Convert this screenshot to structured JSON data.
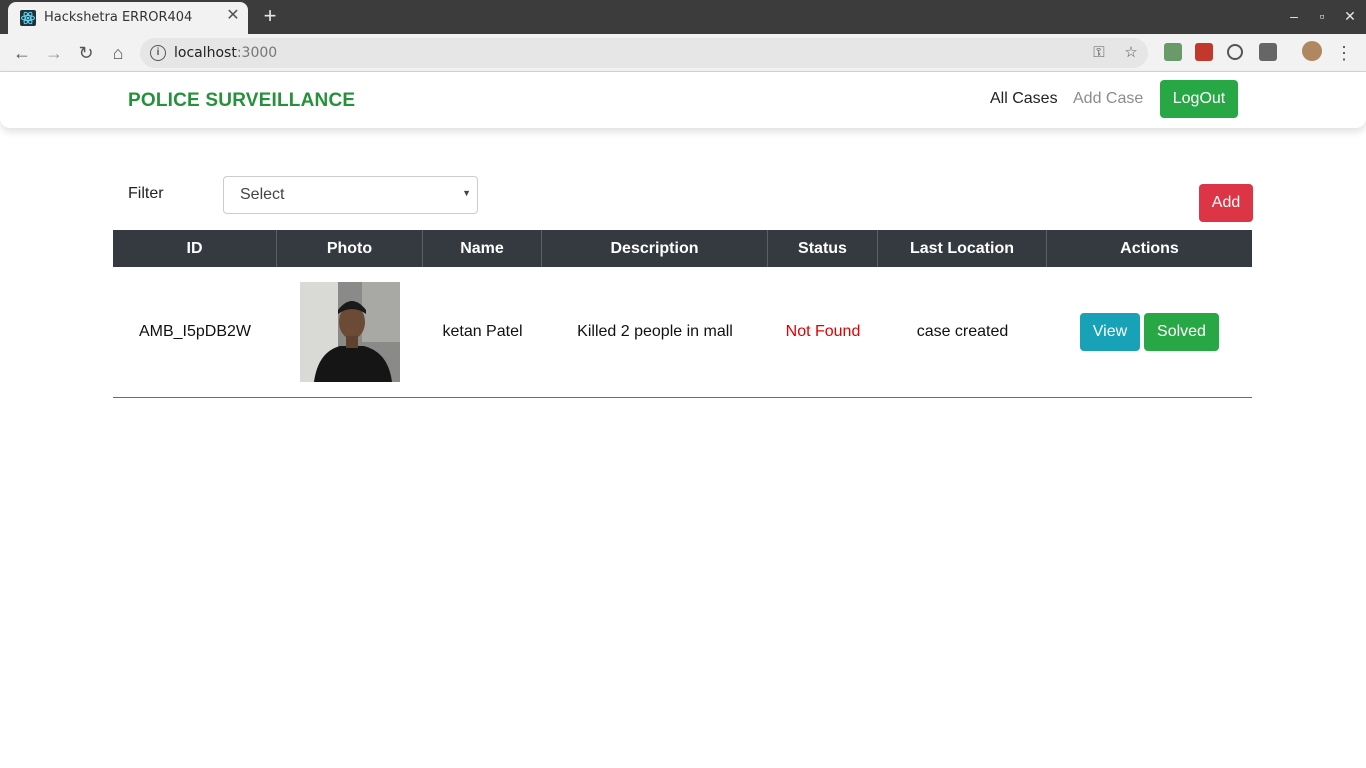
{
  "browser": {
    "tab_title": "Hackshetra ERROR404",
    "url_host": "localhost",
    "url_port": ":3000"
  },
  "app": {
    "brand": "POLICE SURVEILLANCE",
    "brand_color": "#26913b",
    "nav": {
      "all_cases": "All Cases",
      "add_case": "Add Case",
      "logout": "LogOut"
    }
  },
  "filter": {
    "label": "Filter",
    "selected": "Select"
  },
  "add_button": "Add",
  "table": {
    "headers": [
      "ID",
      "Photo",
      "Name",
      "Description",
      "Status",
      "Last Location",
      "Actions"
    ],
    "rows": [
      {
        "id": "AMB_I5pDB2W",
        "name": "ketan Patel",
        "description": "Killed 2 people in mall",
        "status": "Not Found",
        "status_color": "#e00000",
        "last_location": "case created",
        "actions": {
          "view": "View",
          "solved": "Solved"
        }
      }
    ]
  }
}
